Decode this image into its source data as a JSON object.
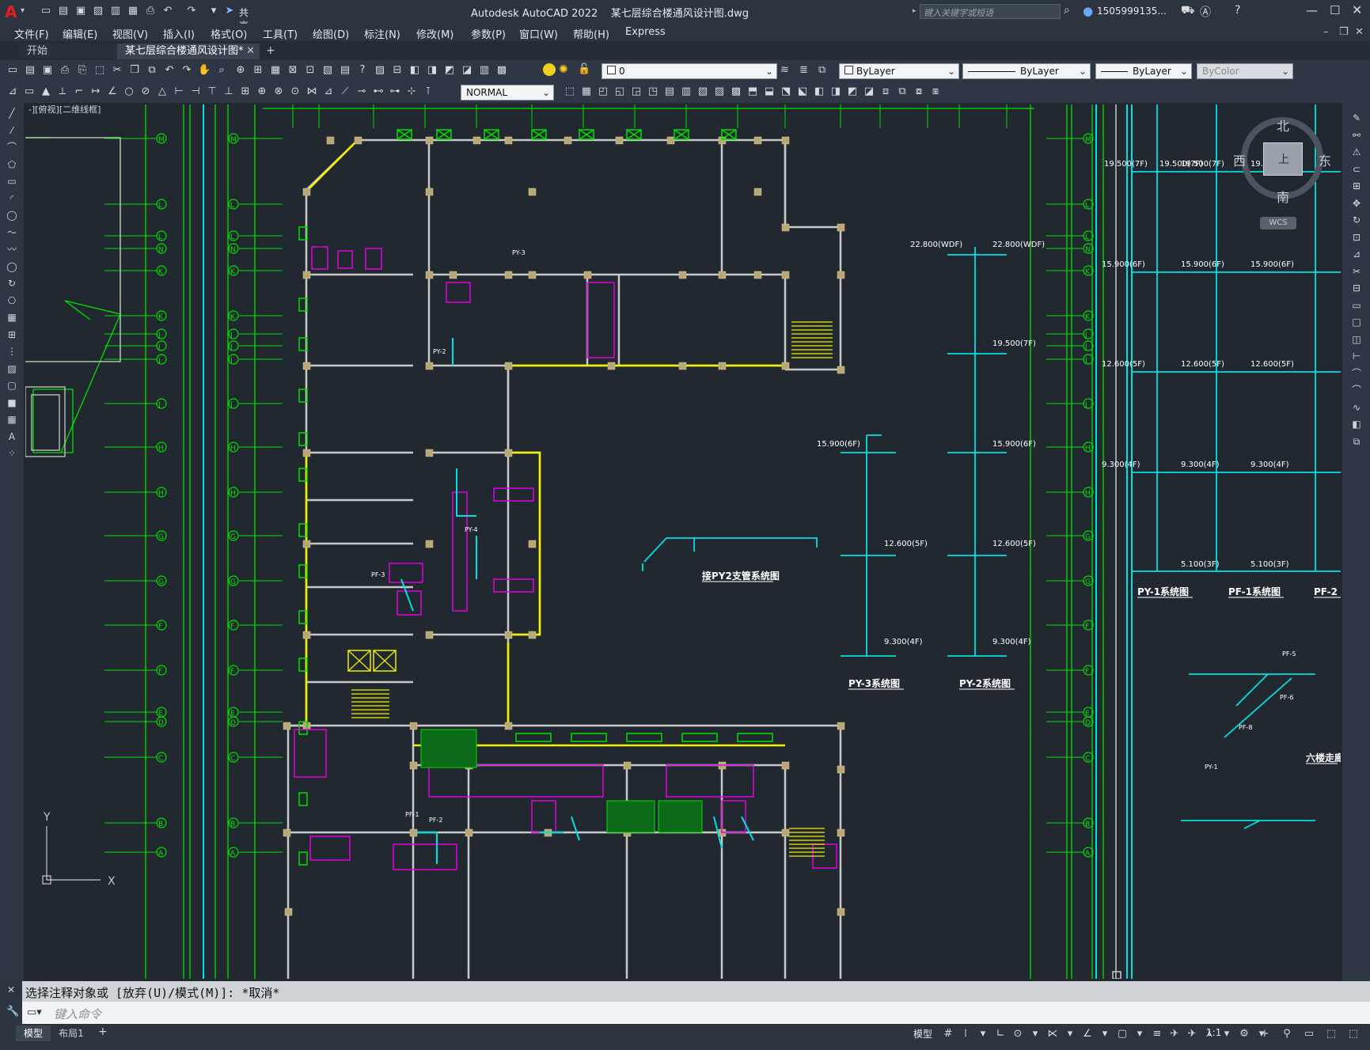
{
  "app": {
    "title": "Autodesk AutoCAD 2022",
    "file": "某七层综合楼通风设计图.dwg",
    "share_label": "共享",
    "search_placeholder": "键入关键字或短语",
    "user": "1505999135...",
    "logo": "A"
  },
  "menu": [
    "文件(F)",
    "编辑(E)",
    "视图(V)",
    "插入(I)",
    "格式(O)",
    "工具(T)",
    "绘图(D)",
    "标注(N)",
    "修改(M)",
    "参数(P)",
    "窗口(W)",
    "帮助(H)",
    "Express"
  ],
  "tabs": [
    {
      "label": "开始",
      "active": false
    },
    {
      "label": "某七层综合楼通风设计图*",
      "active": true
    }
  ],
  "toolbar": {
    "layer_value": "0",
    "color_value": "ByLayer",
    "linetype_value": "ByLayer",
    "lineweight_value": "ByLayer",
    "plotstyle_value": "ByColor",
    "dimstyle_value": "NORMAL"
  },
  "viewport_label": "-][俯视][二维线框]",
  "viewcube": {
    "north": "北",
    "south": "南",
    "east": "东",
    "west": "西",
    "top": "上",
    "wcs": "WCS"
  },
  "drawing": {
    "grid_labels_left": [
      "M",
      "L",
      "N",
      "K",
      "J",
      "H",
      "G",
      "F",
      "E",
      "D",
      "C",
      "B",
      "A"
    ],
    "elevations_right": [
      "19.500(7F)",
      "15.900(6F)",
      "12.600(5F)",
      "9.300(4F)",
      "5.100(3F)"
    ],
    "elevations_py3": [
      "15.900(6F)",
      "12.600(5F)",
      "9.300(4F)"
    ],
    "elevations_py2": [
      "22.800(WDF)",
      "19.500(7F)",
      "15.900(6F)",
      "12.600(5F)",
      "9.300(4F)"
    ],
    "elevation_roof_left": "22.800(WDF)",
    "system_titles": [
      "PY-1系统图",
      "PF-1系统图",
      "PF-2",
      "PY-3系统图",
      "PY-2系统图",
      "接PY2支管系统图",
      "六楼走廊"
    ],
    "room_tags": [
      "PF-5",
      "PF-6",
      "PF-8",
      "PY-1",
      "PY-2",
      "PY-3",
      "PY-4",
      "PF-1",
      "PF-2",
      "PF-3"
    ]
  },
  "command": {
    "history": "选择注释对象或 [放弃(U)/模式(M)]: *取消*",
    "placeholder": "键入命令"
  },
  "status": {
    "tabs": [
      "模型",
      "布局1"
    ],
    "add_tab": "+",
    "model_button": "模型",
    "scale": "1:1"
  },
  "colors": {
    "bg": "#212830",
    "green": "#00e000",
    "yellow": "#f0f000",
    "cyan": "#00e0e0",
    "magenta": "#e000e0",
    "wall": "#c8c8c8",
    "column": "#b8a878"
  }
}
